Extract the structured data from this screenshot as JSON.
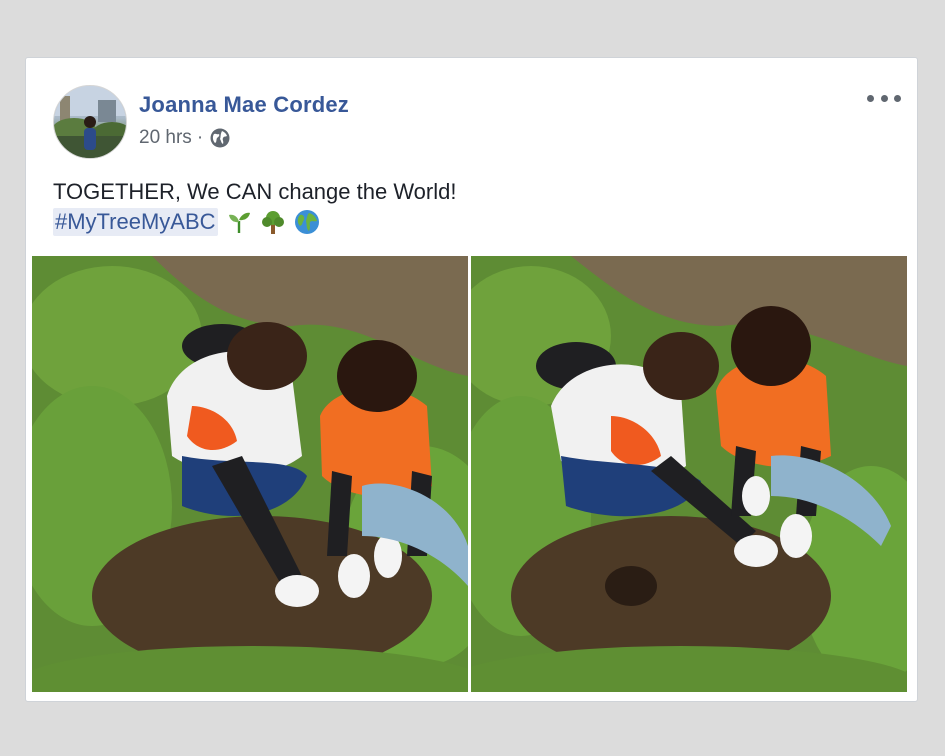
{
  "post": {
    "author": "Joanna Mae Cordez",
    "timestamp": "20 hrs",
    "separator": "·",
    "privacy_icon": "globe-icon",
    "text": "TOGETHER, We CAN change the World!",
    "hashtag": "#MyTreeMyABC",
    "emojis": [
      "seedling-emoji",
      "tree-emoji",
      "globe-earth-emoji"
    ],
    "photos": [
      {
        "name": "photo-tree-planting-1",
        "subject": "two volunteers planting a seedling"
      },
      {
        "name": "photo-tree-planting-2",
        "subject": "two volunteers planting a seedling"
      }
    ]
  },
  "colors": {
    "author": "#385898",
    "meta": "#606770",
    "text": "#1d2129",
    "hashtag_bg": "#e7ebf5",
    "page_bg": "#dcdcdc"
  }
}
